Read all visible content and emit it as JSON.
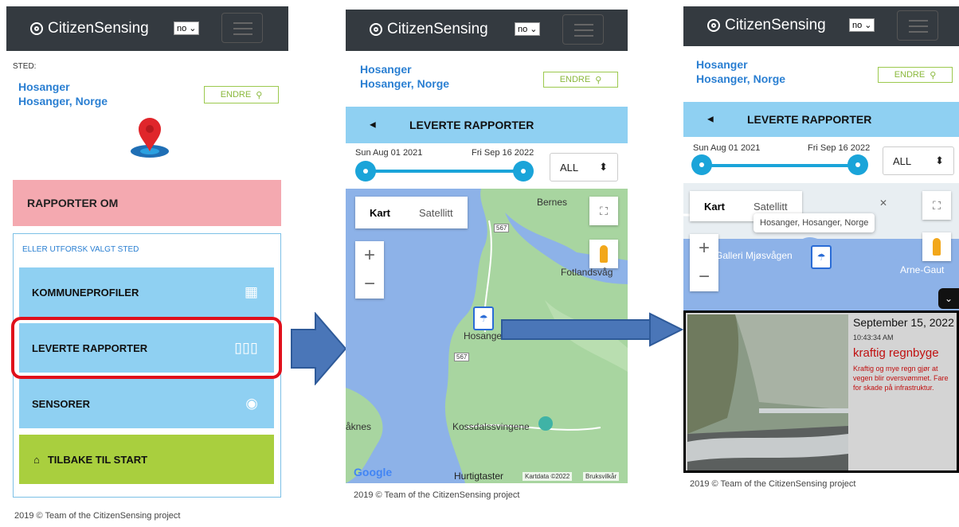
{
  "brand": "CitizenSensing",
  "language": "no",
  "screen1": {
    "sted_label": "STED:",
    "location_name": "Hosanger",
    "location_full": "Hosanger, Norge",
    "endre_label": "ENDRE",
    "rapporter_om": "RAPPORTER OM",
    "explore_label": "ELLER UTFORSK VALGT STED",
    "menu": [
      {
        "label": "KOMMUNEPROFILER",
        "icon": "building-icon"
      },
      {
        "label": "LEVERTE RAPPORTER",
        "icon": "map-icon"
      },
      {
        "label": "SENSORER",
        "icon": "sensor-icon"
      }
    ],
    "home_label": "TILBAKE TIL START",
    "footer": "2019 © Team of the CitizenSensing project"
  },
  "screen2": {
    "location_name": "Hosanger",
    "location_full": "Hosanger, Norge",
    "endre_label": "ENDRE",
    "reports_title": "LEVERTE RAPPORTER",
    "date_start": "Sun Aug 01 2021",
    "date_end": "Fri Sep 16 2022",
    "filter": "ALL",
    "map_tab_kart": "Kart",
    "map_tab_sat": "Satellitt",
    "labels": {
      "bernes": "Bernes",
      "fotland": "Fotlandsvåg",
      "hosanger": "Hosanger",
      "aknes": "åknes",
      "kossdal": "Kossdalssvingene",
      "r567a": "567",
      "r567b": "567"
    },
    "google": "Google",
    "hurtig": "Hurtigtaster",
    "kartdata": "Kartdata ©2022",
    "bruksvilkar": "Bruksvilkår",
    "footer": "2019 © Team of the CitizenSensing project"
  },
  "screen3": {
    "location_name": "Hosanger",
    "location_full": "Hosanger, Norge",
    "endre_label": "ENDRE",
    "reports_title": "LEVERTE RAPPORTER",
    "date_start": "Sun Aug 01 2021",
    "date_end": "Fri Sep 16 2022",
    "filter": "ALL",
    "map_tab_kart": "Kart",
    "map_tab_sat": "Satellitt",
    "popup": "Hosanger, Hosanger, Norge",
    "galleri": "Galleri Mjøsvågen",
    "arne": "Arne-Gaut",
    "card_date": "September 15, 2022",
    "card_time": "10:43:34 AM",
    "card_title": "kraftig regnbyge",
    "card_desc": "Kraftig og mye regn gjør at vegen blir oversvømmet. Fare for skade på infrastruktur.",
    "footer": "2019 © Team of the CitizenSensing project"
  },
  "colors": {
    "navbar": "#343a40",
    "accent_blue": "#8fd0f2",
    "pink": "#f4a9b0",
    "green": "#a9cf3e",
    "highlight": "#e0101b",
    "arrow": "#4a76b8"
  }
}
